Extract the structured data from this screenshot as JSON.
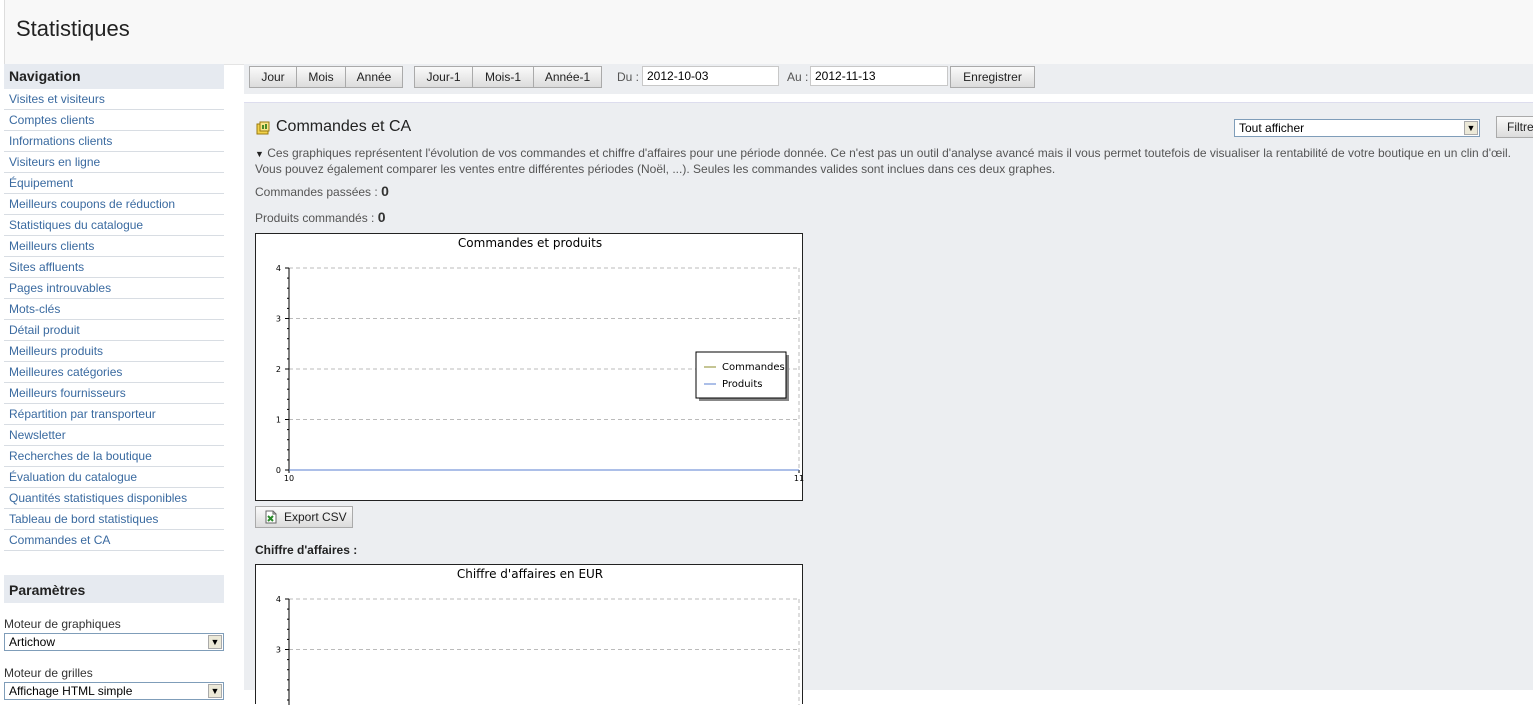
{
  "header": {
    "title": "Statistiques"
  },
  "sidebar": {
    "nav_title": "Navigation",
    "items": [
      "Visites et visiteurs",
      "Comptes clients",
      "Informations clients",
      "Visiteurs en ligne",
      "Équipement",
      "Meilleurs coupons de réduction",
      "Statistiques du catalogue",
      "Meilleurs clients",
      "Sites affluents",
      "Pages introuvables",
      "Mots-clés",
      "Détail produit",
      "Meilleurs produits",
      "Meilleures catégories",
      "Meilleurs fournisseurs",
      "Répartition par transporteur",
      "Newsletter",
      "Recherches de la boutique",
      "Évaluation du catalogue",
      "Quantités statistiques disponibles",
      "Tableau de bord statistiques",
      "Commandes et CA"
    ],
    "params_title": "Paramètres",
    "graph_engine_label": "Moteur de graphiques",
    "graph_engine_value": "Artichow",
    "grid_engine_label": "Moteur de grilles",
    "grid_engine_value": "Affichage HTML simple"
  },
  "toolbar": {
    "day": "Jour",
    "month": "Mois",
    "year": "Année",
    "day_prev": "Jour-1",
    "month_prev": "Mois-1",
    "year_prev": "Année-1",
    "from_label": "Du :",
    "from_value": "2012-10-03",
    "to_label": "Au :",
    "to_value": "2012-11-13",
    "save": "Enregistrer"
  },
  "main": {
    "title": "Commandes et CA",
    "filter_value": "Tout afficher",
    "filter_button": "Filtre",
    "description": "Ces graphiques représentent l'évolution de vos commandes et chiffre d'affaires pour une période donnée. Ce n'est pas un outil d'analyse avancé mais il vous permet toutefois de visualiser la rentabilité de votre boutique en un clin d'œil. Vous pouvez également comparer les ventes entre différentes périodes (Noël, ...). Seules les commandes valides sont inclues dans ces deux graphes.",
    "orders_label": "Commandes passées :",
    "orders_value": "0",
    "products_label": "Produits commandés :",
    "products_value": "0",
    "export_csv": "Export CSV",
    "revenue_label": "Chiffre d'affaires :"
  },
  "colors": {
    "orders_series": "#8b8b2a",
    "products_series": "#5a7fd0",
    "link": "#3a6aa0"
  },
  "chart_data": [
    {
      "type": "line",
      "title": "Commandes et produits",
      "x": [
        10,
        11
      ],
      "ylim": [
        0,
        4
      ],
      "yticks": [
        0,
        1,
        2,
        3,
        4
      ],
      "grid": true,
      "legend": "right",
      "series": [
        {
          "name": "Commandes",
          "values": [
            0,
            0
          ]
        },
        {
          "name": "Produits",
          "values": [
            0,
            0
          ]
        }
      ]
    },
    {
      "type": "line",
      "title": "Chiffre d'affaires en EUR",
      "ylim": [
        0,
        4
      ],
      "yticks": [
        3,
        4
      ],
      "grid": true,
      "series": []
    }
  ]
}
